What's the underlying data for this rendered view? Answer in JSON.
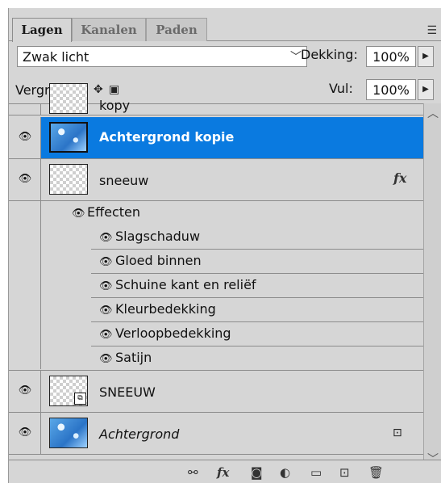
{
  "tabs": [
    "Lagen",
    "Kanalen",
    "Paden"
  ],
  "panel_menu_icon": "panel-menu-icon",
  "blend_mode": "Zwak licht",
  "opacity": {
    "label": "Dekking:",
    "value": "100%"
  },
  "lock": {
    "label": "Vergr.:",
    "icons": [
      "lock-transparent-icon",
      "lock-brush-icon",
      "lock-move-icon",
      "lock-all-icon"
    ]
  },
  "fill": {
    "label": "Vul:",
    "value": "100%"
  },
  "layers": {
    "partial_top": "kopy",
    "selected": {
      "name": "Achtergrond kopie"
    },
    "sneeuw": {
      "name": "sneeuw",
      "fx": "fx"
    },
    "effects_header": "Effecten",
    "effects": [
      "Slagschaduw",
      "Gloed binnen",
      "Schuine kant en reliëf",
      "Kleurbedekking",
      "Verloopbedekking",
      "Satijn"
    ],
    "sneeuw_smart": {
      "name": "SNEEUW"
    },
    "background": {
      "name": "Achtergrond"
    }
  },
  "accent_color": "#0a7ae0",
  "bottom_icons": [
    "link-icon",
    "fx-icon",
    "mask-icon",
    "adjustment-icon",
    "folder-icon",
    "new-layer-icon",
    "trash-icon"
  ],
  "bottom_fx_text": "fx"
}
